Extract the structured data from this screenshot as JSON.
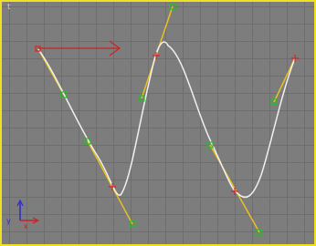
{
  "viewport": {
    "label": "t",
    "border_color": "#f0e020",
    "grid_color": "#6e6e6e",
    "background_color": "#7d7d7d"
  },
  "axis_gizmo": {
    "y_label": "y",
    "x_label": "x",
    "y_color": "#2a2ad0",
    "x_color": "#d02020"
  },
  "spline": {
    "curve_color": "#f0f0f0",
    "tangent_color": "#e8c020",
    "vertex_color": "#e02020",
    "handle_color": "#20c020"
  },
  "move_gizmo": {
    "color": "#d02020"
  }
}
